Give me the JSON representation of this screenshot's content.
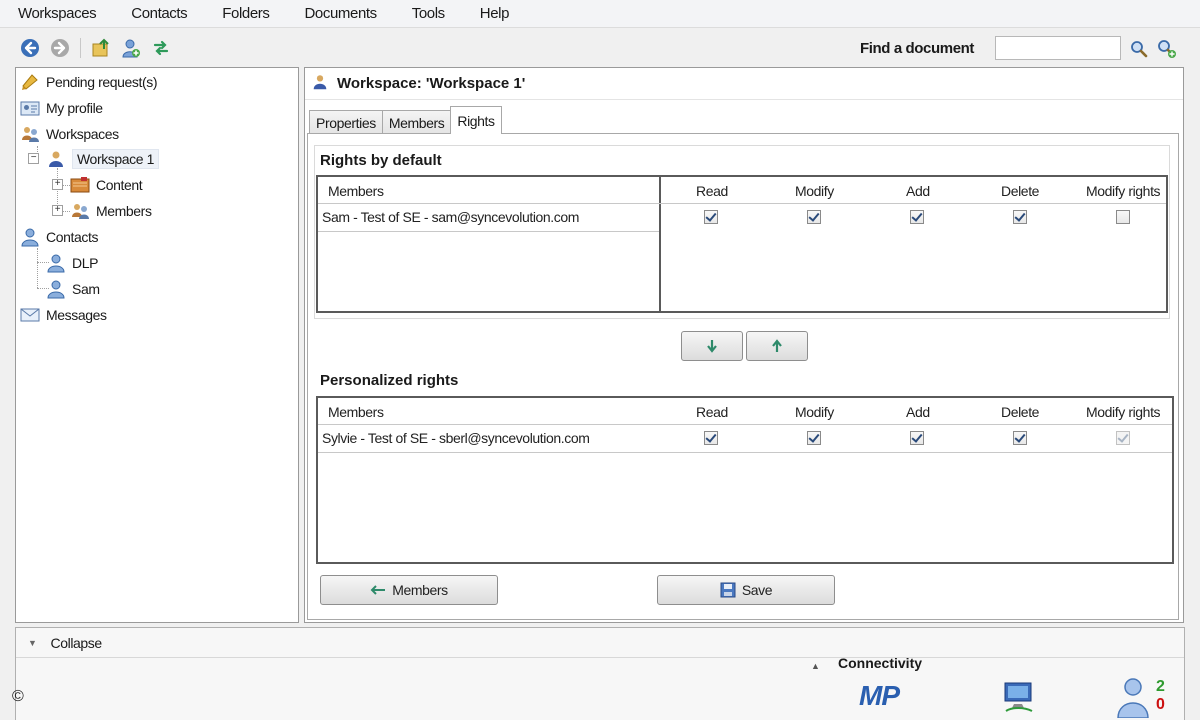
{
  "menu": [
    "Workspaces",
    "Contacts",
    "Folders",
    "Documents",
    "Tools",
    "Help"
  ],
  "toolbar": {
    "find_label": "Find a document",
    "find_value": ""
  },
  "tree": {
    "pending": "Pending request(s)",
    "profile": "My profile",
    "workspaces": "Workspaces",
    "workspace1": "Workspace 1",
    "content": "Content",
    "members": "Members",
    "contacts": "Contacts",
    "dlp": "DLP",
    "sam": "Sam",
    "messages": "Messages"
  },
  "workspace": {
    "title": "Workspace: 'Workspace 1'",
    "tabs": [
      "Properties",
      "Members",
      "Rights"
    ],
    "active_tab": "Rights"
  },
  "rights_default": {
    "title": "Rights by default",
    "columns": [
      "Members",
      "Read",
      "Modify",
      "Add",
      "Delete",
      "Modify rights"
    ],
    "rows": [
      {
        "member": "Sam - Test of SE - sam@syncevolution.com",
        "read": true,
        "modify": true,
        "add": true,
        "delete": true,
        "modify_rights": false
      }
    ]
  },
  "rights_personal": {
    "title": "Personalized rights",
    "columns": [
      "Members",
      "Read",
      "Modify",
      "Add",
      "Delete",
      "Modify rights"
    ],
    "rows": [
      {
        "member": "Sylvie - Test of SE - sberl@syncevolution.com",
        "read": true,
        "modify": true,
        "add": true,
        "delete": true,
        "modify_rights": true
      }
    ]
  },
  "buttons": {
    "members": "Members",
    "save": "Save"
  },
  "bottom": {
    "collapse": "Collapse",
    "connectivity": "Connectivity",
    "mp_logo": "MP",
    "count_online": "2",
    "count_offline": "0",
    "copyright": "©"
  },
  "colors": {
    "accent_blue": "#2a5fb0",
    "online_green": "#2e9a2e",
    "offline_red": "#cc1111"
  }
}
